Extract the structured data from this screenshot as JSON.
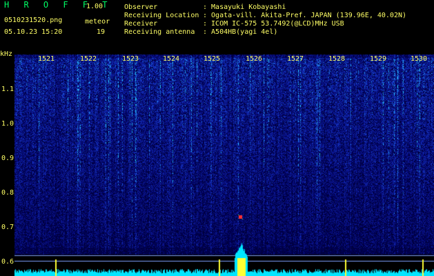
{
  "app": {
    "title": "H R O F F T",
    "version": "1.00"
  },
  "file": {
    "name": "0510231520.png",
    "datetime": "05.10.23 15:20"
  },
  "counter": {
    "label": "meteor",
    "value": "19"
  },
  "info": {
    "observer_label": "Observer",
    "observer_value": ": Masayuki Kobayashi",
    "location_label": "Receiving Location",
    "location_value": ": Ogata-vill. Akita-Pref. JAPAN (139.96E, 40.02N)",
    "receiver_label": "Receiver",
    "receiver_value": ": ICOM IC-575 53.7492(@LCD)MHz USB",
    "antenna_label": "Receiving antenna",
    "antenna_value": ": A504HB(yagi 4el)"
  },
  "axis": {
    "y_unit": "kHz",
    "y_ticks": [
      "1.1",
      "1.0",
      "0.9",
      "0.8",
      "0.7",
      "0.6"
    ],
    "x_ticks": [
      "1521",
      "1522",
      "1523",
      "1524",
      "1525",
      "1526",
      "1527",
      "1528",
      "1529",
      "1530"
    ]
  },
  "colors": {
    "text": "#ffff66",
    "title": "#00ff66",
    "background": "#000000",
    "spectrum_base": "#000080",
    "trace": "#00e5ff"
  }
}
